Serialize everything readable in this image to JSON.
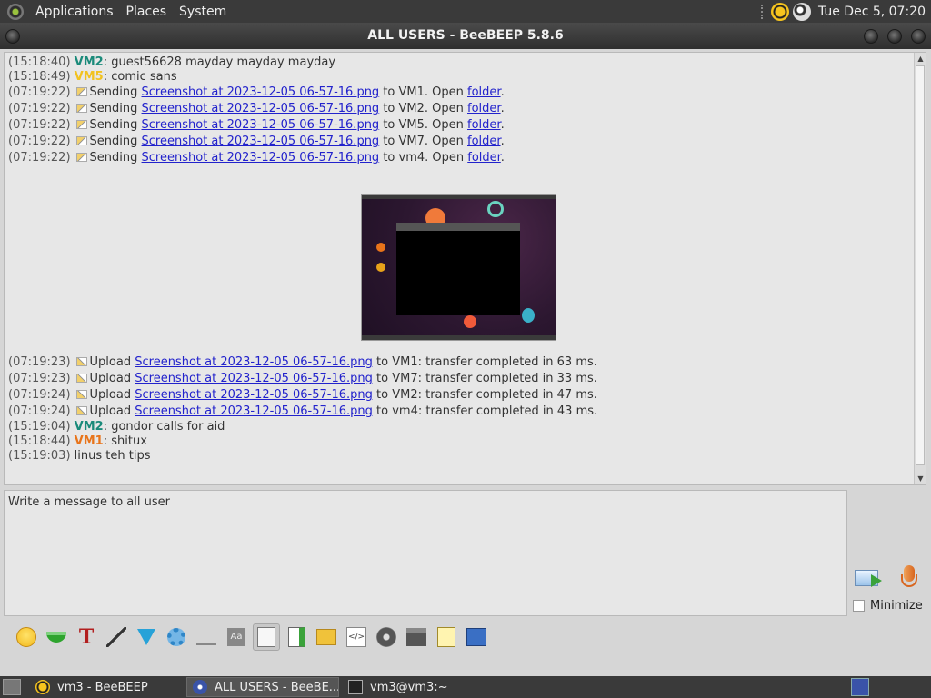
{
  "top_panel": {
    "menus": [
      "Applications",
      "Places",
      "System"
    ],
    "clock": "Tue Dec  5, 07:20"
  },
  "window": {
    "title": "ALL USERS - BeeBEEP 5.8.6"
  },
  "chat": {
    "messages_top": [
      {
        "time": "(15:18:40)",
        "nick": "VM2",
        "nick_color": "#1a8a7a",
        "text": ": guest56628 mayday mayday mayday"
      },
      {
        "time": "(15:18:49)",
        "nick": "VM5",
        "nick_color": "#f2c21f",
        "text": ": comic sans"
      }
    ],
    "sending": [
      {
        "time": "(07:19:22)",
        "verb": "Sending",
        "file": "Screenshot at 2023-12-05 06-57-16.png",
        "to": " to VM1. Open ",
        "folder": "folder",
        "end": "."
      },
      {
        "time": "(07:19:22)",
        "verb": "Sending",
        "file": "Screenshot at 2023-12-05 06-57-16.png",
        "to": " to VM2. Open ",
        "folder": "folder",
        "end": "."
      },
      {
        "time": "(07:19:22)",
        "verb": "Sending",
        "file": "Screenshot at 2023-12-05 06-57-16.png",
        "to": " to VM5. Open ",
        "folder": "folder",
        "end": "."
      },
      {
        "time": "(07:19:22)",
        "verb": "Sending",
        "file": "Screenshot at 2023-12-05 06-57-16.png",
        "to": " to VM7. Open ",
        "folder": "folder",
        "end": "."
      },
      {
        "time": "(07:19:22)",
        "verb": "Sending",
        "file": "Screenshot at 2023-12-05 06-57-16.png",
        "to": " to vm4. Open ",
        "folder": "folder",
        "end": "."
      }
    ],
    "uploads": [
      {
        "time": "(07:19:23)",
        "verb": "Upload",
        "file": "Screenshot at 2023-12-05 06-57-16.png",
        "rest": " to VM1: transfer completed in 63 ms."
      },
      {
        "time": "(07:19:23)",
        "verb": "Upload",
        "file": "Screenshot at 2023-12-05 06-57-16.png",
        "rest": " to VM7: transfer completed in 33 ms."
      },
      {
        "time": "(07:19:24)",
        "verb": "Upload",
        "file": "Screenshot at 2023-12-05 06-57-16.png",
        "rest": " to VM2: transfer completed in 47 ms."
      },
      {
        "time": "(07:19:24)",
        "verb": "Upload",
        "file": "Screenshot at 2023-12-05 06-57-16.png",
        "rest": " to vm4: transfer completed in 43 ms."
      }
    ],
    "messages_bottom": [
      {
        "time": "(15:19:04)",
        "nick": "VM2",
        "nick_color": "#1a8a7a",
        "text": ": gondor calls for aid"
      },
      {
        "time": "(15:18:44)",
        "nick": "VM1",
        "nick_color": "#e8741a",
        "text": ": shitux"
      },
      {
        "time": "(15:19:03)",
        "nick": "",
        "nick_color": "#333333",
        "text": "  linus teh tips"
      }
    ]
  },
  "input": {
    "value": "Write a message to all user"
  },
  "side": {
    "minimize_label": "Minimize"
  },
  "toolbar_icons": [
    "emoji-icon",
    "bowl-icon",
    "font-icon",
    "wand-icon",
    "filter-icon",
    "gear-icon",
    "spellcheck-icon",
    "font-size-icon",
    "note-icon",
    "send-file-icon",
    "folder-icon",
    "code-icon",
    "disc-icon",
    "terminal-icon",
    "edit-icon",
    "save-icon"
  ],
  "taskbar": {
    "tasks": [
      "vm3 - BeeBEEP",
      "ALL USERS - BeeBE...",
      "vm3@vm3:~"
    ]
  }
}
